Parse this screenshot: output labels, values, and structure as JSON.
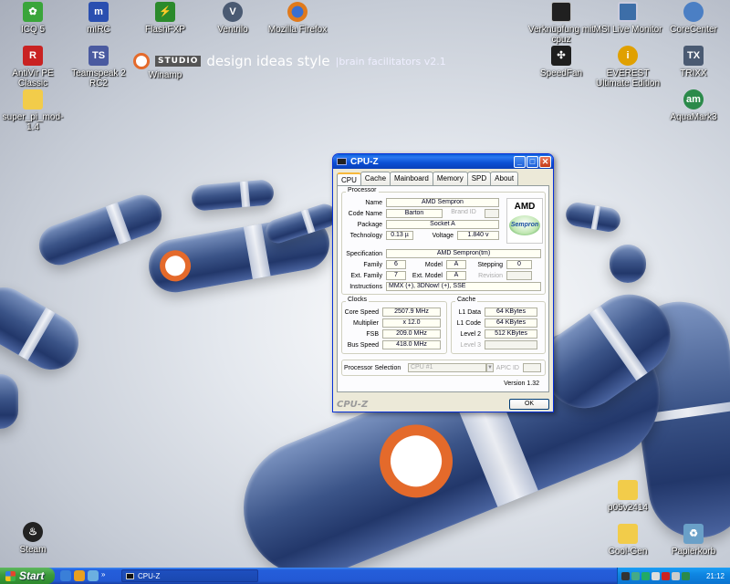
{
  "desktop": {
    "brand": {
      "studio": "STUDIO",
      "main": "design ideas style",
      "sub": "|brain facilitators v2.1"
    },
    "icons_left": [
      {
        "label": "ICQ 5",
        "color": "#3aa53a",
        "icon": "icq-flower"
      },
      {
        "label": "mIRC",
        "color": "#2a4fb0",
        "icon": "mirc-logo"
      },
      {
        "label": "FlashFXP",
        "color": "#2b8a2b",
        "icon": "flashfxp-logo"
      },
      {
        "label": "Ventrilo",
        "color": "#4a5a72",
        "icon": "ventrilo-logo"
      },
      {
        "label": "Mozilla Firefox",
        "color": "#e07a1c",
        "icon": "firefox-logo"
      },
      {
        "label": "AntiVir PE Classic",
        "color": "#c92222",
        "icon": "antivir-umbrella"
      },
      {
        "label": "Teamspeak 2 RC2",
        "color": "#4a5aa0",
        "icon": "teamspeak-logo"
      },
      {
        "label": "Winamp",
        "color": "#e46a2b",
        "icon": "winamp-logo"
      },
      {
        "label": "super_pi_mod-1.4",
        "color": "#f2cc4a",
        "icon": "folder-icon"
      }
    ],
    "icons_right": [
      {
        "label": "Verknüpfung mit cpuz",
        "color": "#202020",
        "icon": "cpuz-chip"
      },
      {
        "label": "MSI Live Monitor",
        "color": "#3d6ea8",
        "icon": "msi-monitor"
      },
      {
        "label": "CoreCenter",
        "color": "#4b7fc4",
        "icon": "corecenter-logo"
      },
      {
        "label": "SpeedFan",
        "color": "#1e1e1e",
        "icon": "speedfan-fan"
      },
      {
        "label": "EVEREST Ultimate Edition",
        "color": "#e0a000",
        "icon": "everest-info"
      },
      {
        "label": "TRIXX",
        "color": "#4a5a72",
        "icon": "trixx-logo"
      },
      {
        "label": "AquaMark3",
        "color": "#2b8a4a",
        "icon": "aquamark-logo"
      },
      {
        "label": "p05v2414",
        "color": "#f2cc4a",
        "icon": "folder-icon"
      },
      {
        "label": "Cool-Gen",
        "color": "#f2cc4a",
        "icon": "folder-icon"
      },
      {
        "label": "Papierkorb",
        "color": "#6aa0c8",
        "icon": "recycle-bin"
      },
      {
        "label": "Steam",
        "color": "#222222",
        "icon": "steam-logo"
      }
    ]
  },
  "cpuz": {
    "title": "CPU-Z",
    "tabs": [
      "CPU",
      "Cache",
      "Mainboard",
      "Memory",
      "SPD",
      "About"
    ],
    "processor": {
      "group_title": "Processor",
      "name_label": "Name",
      "name": "AMD Sempron",
      "codename_label": "Code Name",
      "codename": "Barton",
      "brand_id_label": "Brand ID",
      "brand_id": "",
      "package_label": "Package",
      "package": "Socket A",
      "technology_label": "Technology",
      "technology": "0.13 µ",
      "voltage_label": "Voltage",
      "voltage": "1.840 v",
      "spec_label": "Specification",
      "spec": "AMD Sempron(tm)",
      "family_label": "Family",
      "family": "6",
      "model_label": "Model",
      "model": "A",
      "stepping_label": "Stepping",
      "stepping": "0",
      "extfamily_label": "Ext. Family",
      "extfamily": "7",
      "extmodel_label": "Ext. Model",
      "extmodel": "A",
      "revision_label": "Revision",
      "revision": "",
      "instructions_label": "Instructions",
      "instructions": "MMX (+), 3DNow! (+), SSE",
      "logo_brand": "AMD",
      "logo_product": "Sempron"
    },
    "clocks": {
      "group_title": "Clocks",
      "core_speed_label": "Core Speed",
      "core_speed": "2507.9 MHz",
      "multiplier_label": "Multiplier",
      "multiplier": "x 12.0",
      "fsb_label": "FSB",
      "fsb": "209.0 MHz",
      "bus_speed_label": "Bus Speed",
      "bus_speed": "418.0 MHz"
    },
    "cache": {
      "group_title": "Cache",
      "l1data_label": "L1 Data",
      "l1data": "64 KBytes",
      "l1code_label": "L1 Code",
      "l1code": "64 KBytes",
      "level2_label": "Level 2",
      "level2": "512 KBytes",
      "level3_label": "Level 3",
      "level3": ""
    },
    "selection": {
      "label": "Processor Selection",
      "value": "CPU #1",
      "apic_label": "APIC ID",
      "apic": ""
    },
    "version": "Version 1.32",
    "watermark": "CPU-Z",
    "ok_label": "OK"
  },
  "taskbar": {
    "start_label": "Start",
    "task_label": "CPU-Z",
    "clock": "21:12"
  }
}
